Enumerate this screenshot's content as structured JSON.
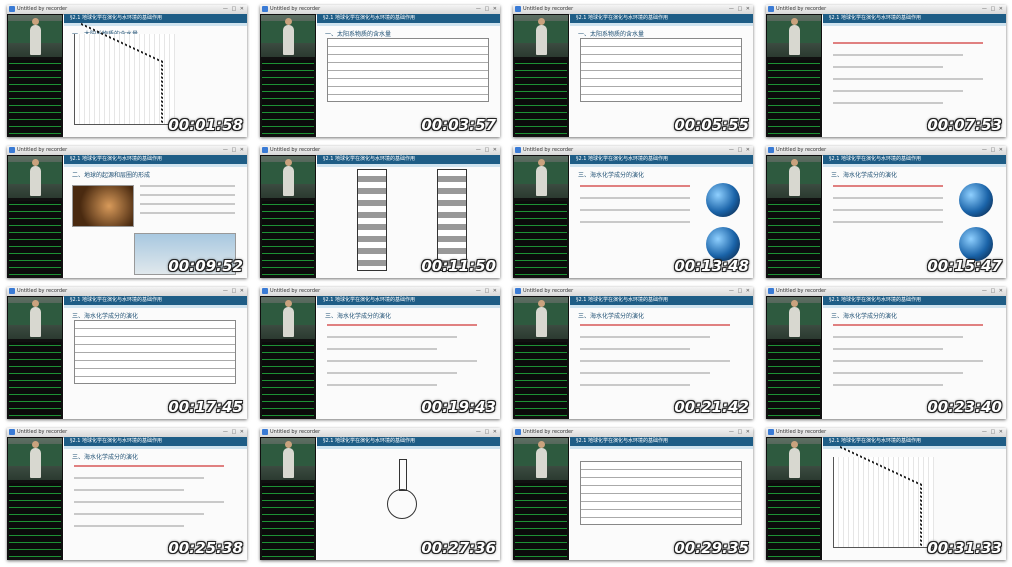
{
  "window_title": "Untitled by recorder",
  "window_buttons": "— □ ✕",
  "slide_header": "§2.1  地球化学在演化与水环境的基础作用",
  "sections": {
    "s1": "一、太阳系物质的含水量",
    "s2": "二、地球的起源和层圈的形成",
    "s3": "三、海水化学成分的演化"
  },
  "tiles": [
    {
      "timestamp": "00:01:58",
      "heading": "一、太阳系物质的含水量",
      "kind": "chart"
    },
    {
      "timestamp": "00:03:57",
      "heading": "一、太阳系物质的含水量",
      "kind": "table"
    },
    {
      "timestamp": "00:05:55",
      "heading": "一、太阳系物质的含水量",
      "kind": "table"
    },
    {
      "timestamp": "00:07:53",
      "heading": "",
      "kind": "text"
    },
    {
      "timestamp": "00:09:52",
      "heading": "二、地球的起源和层圈的形成",
      "kind": "image"
    },
    {
      "timestamp": "00:11:50",
      "heading": "",
      "kind": "columns"
    },
    {
      "timestamp": "00:13:48",
      "heading": "三、海水化学成分的演化",
      "kind": "earth"
    },
    {
      "timestamp": "00:15:47",
      "heading": "三、海水化学成分的演化",
      "kind": "earth"
    },
    {
      "timestamp": "00:17:45",
      "heading": "三、海水化学成分的演化",
      "kind": "table"
    },
    {
      "timestamp": "00:19:43",
      "heading": "三、海水化学成分的演化",
      "kind": "text"
    },
    {
      "timestamp": "00:21:42",
      "heading": "三、海水化学成分的演化",
      "kind": "text"
    },
    {
      "timestamp": "00:23:40",
      "heading": "三、海水化学成分的演化",
      "kind": "text"
    },
    {
      "timestamp": "00:25:38",
      "heading": "三、海水化学成分的演化",
      "kind": "text"
    },
    {
      "timestamp": "00:27:36",
      "heading": "",
      "kind": "flask"
    },
    {
      "timestamp": "00:29:35",
      "heading": "",
      "kind": "table"
    },
    {
      "timestamp": "00:31:33",
      "heading": "",
      "kind": "chart"
    }
  ],
  "colors": {
    "header_blue": "#1e5d86",
    "timestamp_text": "#ffffff",
    "chat_green": "#1fa83a"
  }
}
